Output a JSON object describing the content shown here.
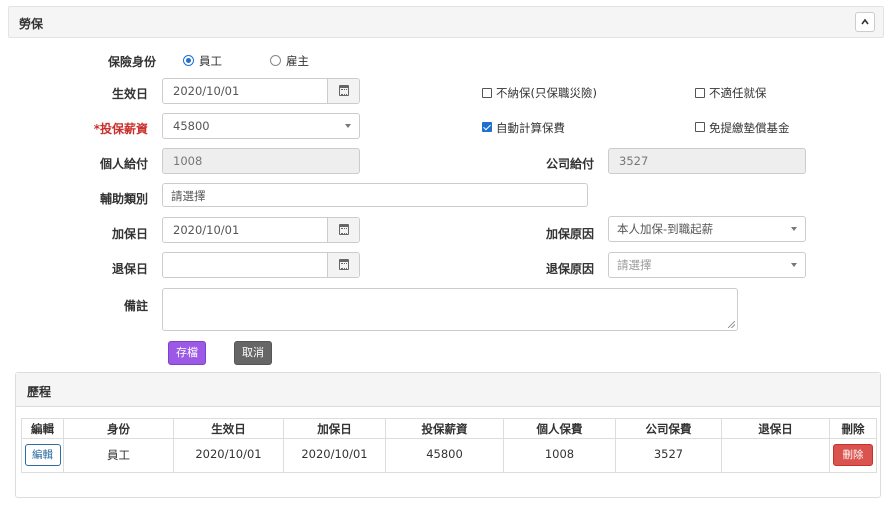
{
  "panel": {
    "title": "勞保",
    "collapse_icon": "chevron-up-icon"
  },
  "form": {
    "identity": {
      "label": "保險身份",
      "options": [
        "員工",
        "雇主"
      ],
      "selected": "員工"
    },
    "effective_date": {
      "label": "生效日",
      "value": "2020/10/01"
    },
    "no_insurance": {
      "label": "不納保(只保職災險)",
      "checked": false
    },
    "not_employment": {
      "label": "不適任就保",
      "checked": false
    },
    "salary": {
      "label": "*投保薪資",
      "value": "45800"
    },
    "auto_calc": {
      "label": "自動計算保費",
      "checked": true
    },
    "exempt_fund": {
      "label": "免提繳墊償基金",
      "checked": false
    },
    "personal_pay": {
      "label": "個人給付",
      "value": "1008"
    },
    "company_pay": {
      "label": "公司給付",
      "value": "3527"
    },
    "subsidy": {
      "label": "輔助類別",
      "value": "請選擇"
    },
    "enroll_date": {
      "label": "加保日",
      "value": "2020/10/01"
    },
    "enroll_reason": {
      "label": "加保原因",
      "value": "本人加保-到職起薪"
    },
    "withdraw_date": {
      "label": "退保日",
      "value": ""
    },
    "withdraw_reason": {
      "label": "退保原因",
      "placeholder": "請選擇"
    },
    "note": {
      "label": "備註",
      "value": ""
    },
    "save_label": "存檔",
    "cancel_label": "取消"
  },
  "history": {
    "title": "歷程",
    "columns": [
      "編輯",
      "身份",
      "生效日",
      "加保日",
      "投保薪資",
      "個人保費",
      "公司保費",
      "退保日",
      "刪除"
    ],
    "rows": [
      {
        "edit_label": "編輯",
        "identity": "員工",
        "effective": "2020/10/01",
        "enroll": "2020/10/01",
        "salary": "45800",
        "personal": "1008",
        "company": "3527",
        "withdraw": "",
        "delete_label": "刪除"
      }
    ]
  },
  "colors": {
    "accent": "#1f6fd1",
    "save": "#9b59e6",
    "cancel": "#666666",
    "danger": "#d9534f",
    "required": "#c9302c"
  }
}
